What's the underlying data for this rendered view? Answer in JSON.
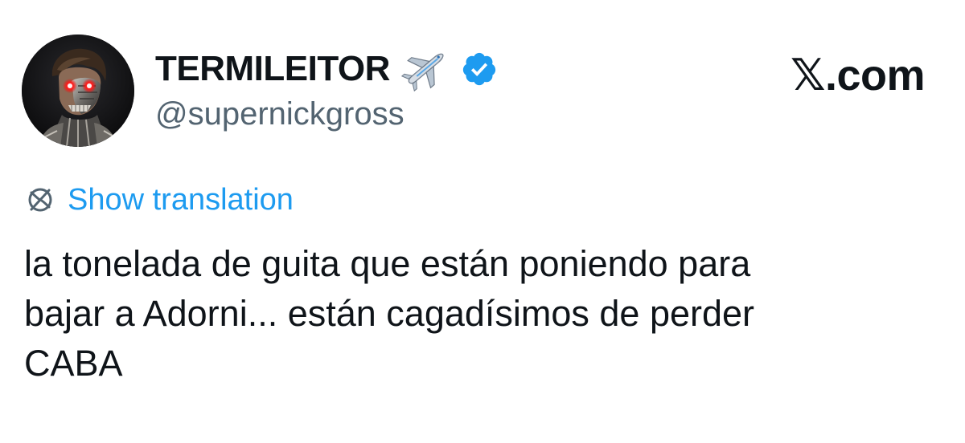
{
  "author": {
    "display_name": "TERMILEITOR",
    "handle": "@supernickgross",
    "avatar_icon": "terminator-robot-avatar",
    "name_emoji_icon": "airplane-icon",
    "verified_icon": "verified-badge-icon"
  },
  "brand": {
    "label": "𝕏.com"
  },
  "translation": {
    "icon": "globe-icon",
    "label": "Show translation"
  },
  "tweet": {
    "lines": [
      "la tonelada de guita que están poniendo para",
      "bajar a Adorni... están cagadísimos de perder",
      "CABA"
    ]
  },
  "colors": {
    "text": "#0f1419",
    "secondary_text": "#536471",
    "link": "#1d9bf0",
    "verified": "#1d9bf0",
    "background": "#ffffff"
  }
}
